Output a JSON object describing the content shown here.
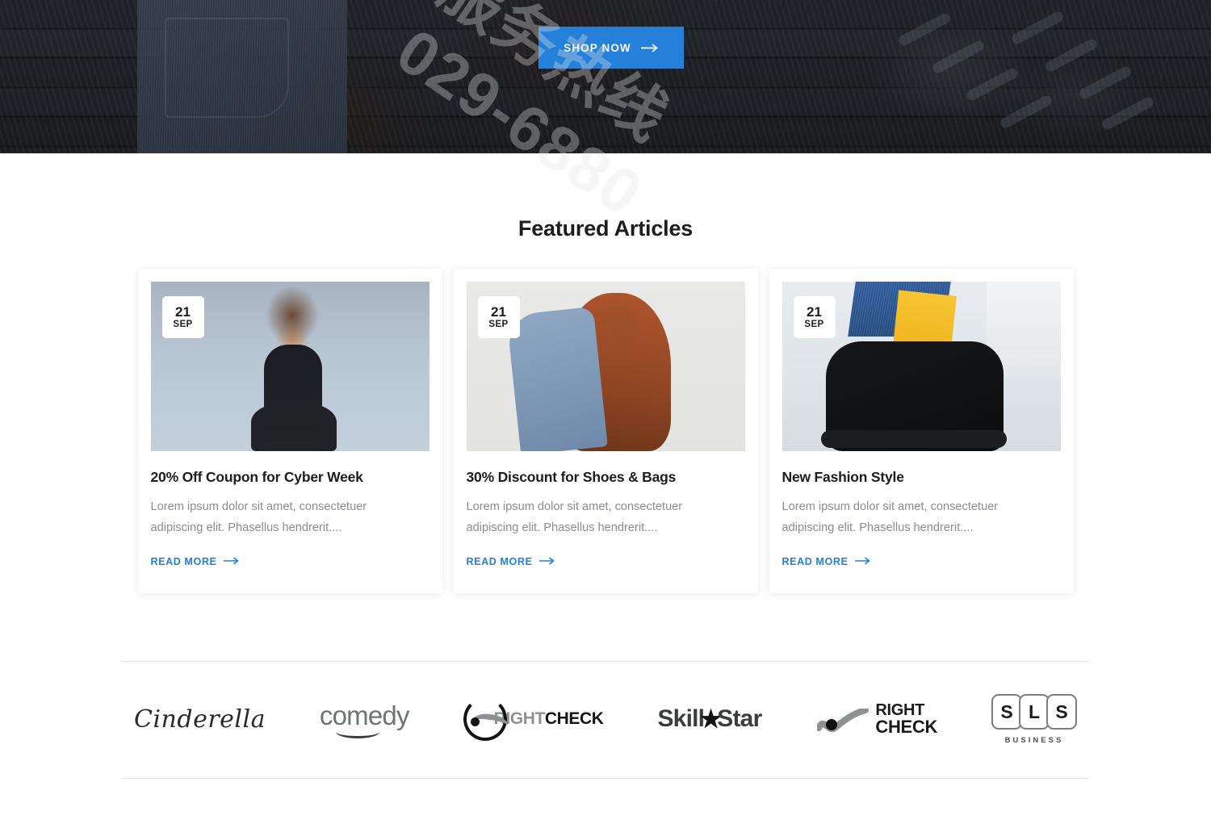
{
  "hero": {
    "cta_label": "SHOP NOW",
    "cta_arrow": "arrow-right-icon",
    "accent_color": "#2480d8"
  },
  "featured": {
    "title": "Featured Articles",
    "cards": [
      {
        "date_day": "21",
        "date_month": "SEP",
        "title": "20% Off Coupon for Cyber Week",
        "excerpt": "Lorem ipsum dolor sit amet, consectetuer adipiscing elit. Phasellus hendrerit....",
        "link_label": "READ MORE",
        "image_alt": "woman-in-black-dress"
      },
      {
        "date_day": "21",
        "date_month": "SEP",
        "title": "30% Discount for Shoes & Bags",
        "excerpt": "Lorem ipsum dolor sit amet, consectetuer adipiscing elit. Phasellus hendrerit....",
        "link_label": "READ MORE",
        "image_alt": "woman-in-denim-jacket"
      },
      {
        "date_day": "21",
        "date_month": "SEP",
        "title": "New Fashion Style",
        "excerpt": "Lorem ipsum dolor sit amet, consectetuer adipiscing elit. Phasellus hendrerit....",
        "link_label": "READ MORE",
        "image_alt": "black-boot-with-yellow-sock"
      }
    ]
  },
  "brands": [
    {
      "name": "Cinderella",
      "style": "script"
    },
    {
      "name": "comedy",
      "style": "smile"
    },
    {
      "name_part1": "RIGHT",
      "name_part2": "CHECK",
      "style": "ring-check"
    },
    {
      "name_part1": "Skill",
      "name_part2": "Star",
      "star": "★",
      "style": "star"
    },
    {
      "name_part1": "RIGHT",
      "name_part2": "CHECK",
      "style": "swoosh-check"
    },
    {
      "letters": [
        "S",
        "L",
        "S"
      ],
      "sub": "BUSINESS",
      "style": "boxed"
    }
  ],
  "watermark": {
    "line1": "服务热线",
    "line2": "029-6880"
  }
}
